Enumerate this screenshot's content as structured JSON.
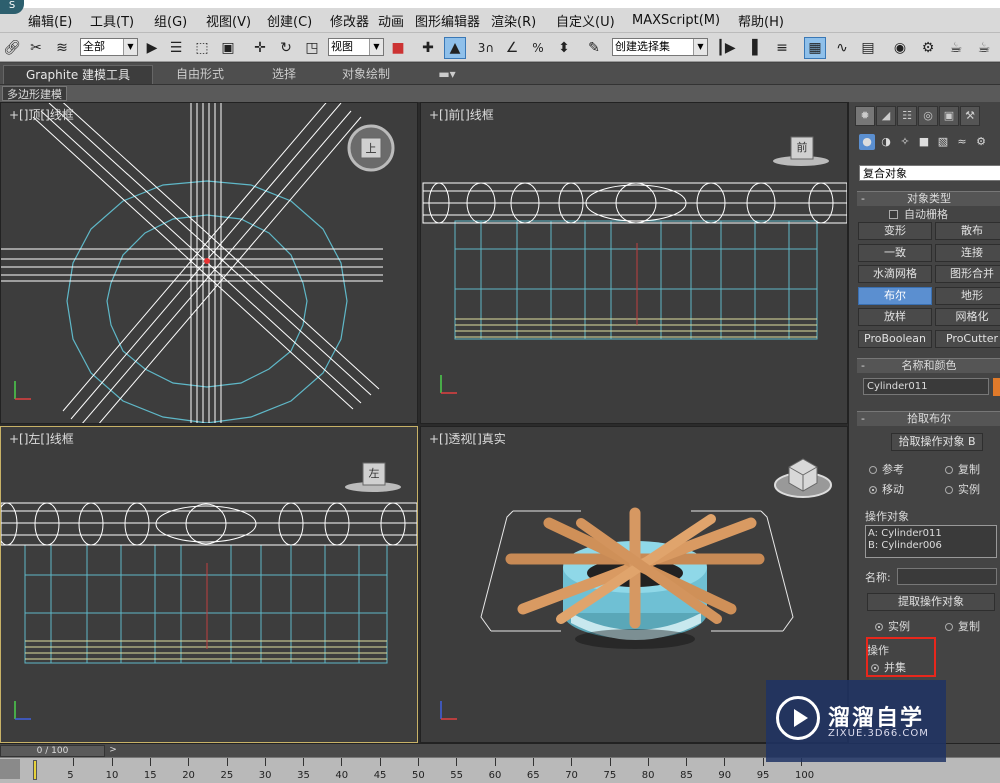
{
  "menu": {
    "items": [
      "编辑(E)",
      "工具(T)",
      "组(G)",
      "视图(V)",
      "创建(C)",
      "修改器",
      "动画",
      "图形编辑器",
      "渲染(R)",
      "自定义(U)",
      "MAXScript(M)",
      "帮助(H)"
    ]
  },
  "toolbar": {
    "selection_filter": "全部",
    "ref_coord": "视图",
    "selection_set": "创建选择集",
    "snap_label": "3"
  },
  "ribbon": {
    "tabs": [
      "Graphite 建模工具",
      "自由形式",
      "选择",
      "对象绘制"
    ],
    "sub_label": "多边形建模"
  },
  "viewports": {
    "top": {
      "label": "+[]顶[]线框 ",
      "cube": "上"
    },
    "front": {
      "label": "+[]前[]线框 ",
      "cube": "前"
    },
    "left": {
      "label": "+[]左[]线框 ",
      "cube": "左"
    },
    "persp": {
      "label": "+[]透视[]真实 "
    }
  },
  "command_panel": {
    "category": "复合对象",
    "object_type": {
      "title": "对象类型",
      "auto_grid": "自动栅格",
      "buttons": [
        "变形",
        "散布",
        "一致",
        "连接",
        "水滴网格",
        "图形合并",
        "布尔",
        "地形",
        "放样",
        "网格化",
        "ProBoolean",
        "ProCutter"
      ],
      "active_index": 6
    },
    "name_color": {
      "title": "名称和颜色",
      "name": "Cylinder011",
      "color": "#e07a2a"
    },
    "pick_boolean": {
      "title": "拾取布尔",
      "pick_button": "拾取操作对象 B",
      "options": [
        "参考",
        "复制",
        "移动",
        "实例"
      ],
      "selected": "移动"
    },
    "parameters": {
      "operands_title": "操作对象",
      "operands": [
        "A: Cylinder011",
        "B: Cylinder006"
      ],
      "name_label": "名称:",
      "extract_button": "提取操作对象",
      "extract_options": [
        "实例",
        "复制"
      ],
      "extract_selected": "实例",
      "operation_title": "操作",
      "operation_selected": "并集"
    }
  },
  "timeline": {
    "slider": "0 / 100",
    "next": ">",
    "ticks": [
      "5",
      "10",
      "15",
      "20",
      "25",
      "30",
      "35",
      "40",
      "45",
      "50",
      "55",
      "60",
      "65",
      "70",
      "75",
      "80",
      "85",
      "90",
      "95",
      "100"
    ]
  },
  "watermark": {
    "title": "溜溜自学",
    "url": "ZIXUE.3D66.COM"
  },
  "colors": {
    "highlight": "#e8271c",
    "active_button": "#5b8fd0",
    "viewport_bg": "#3d3d3d"
  }
}
